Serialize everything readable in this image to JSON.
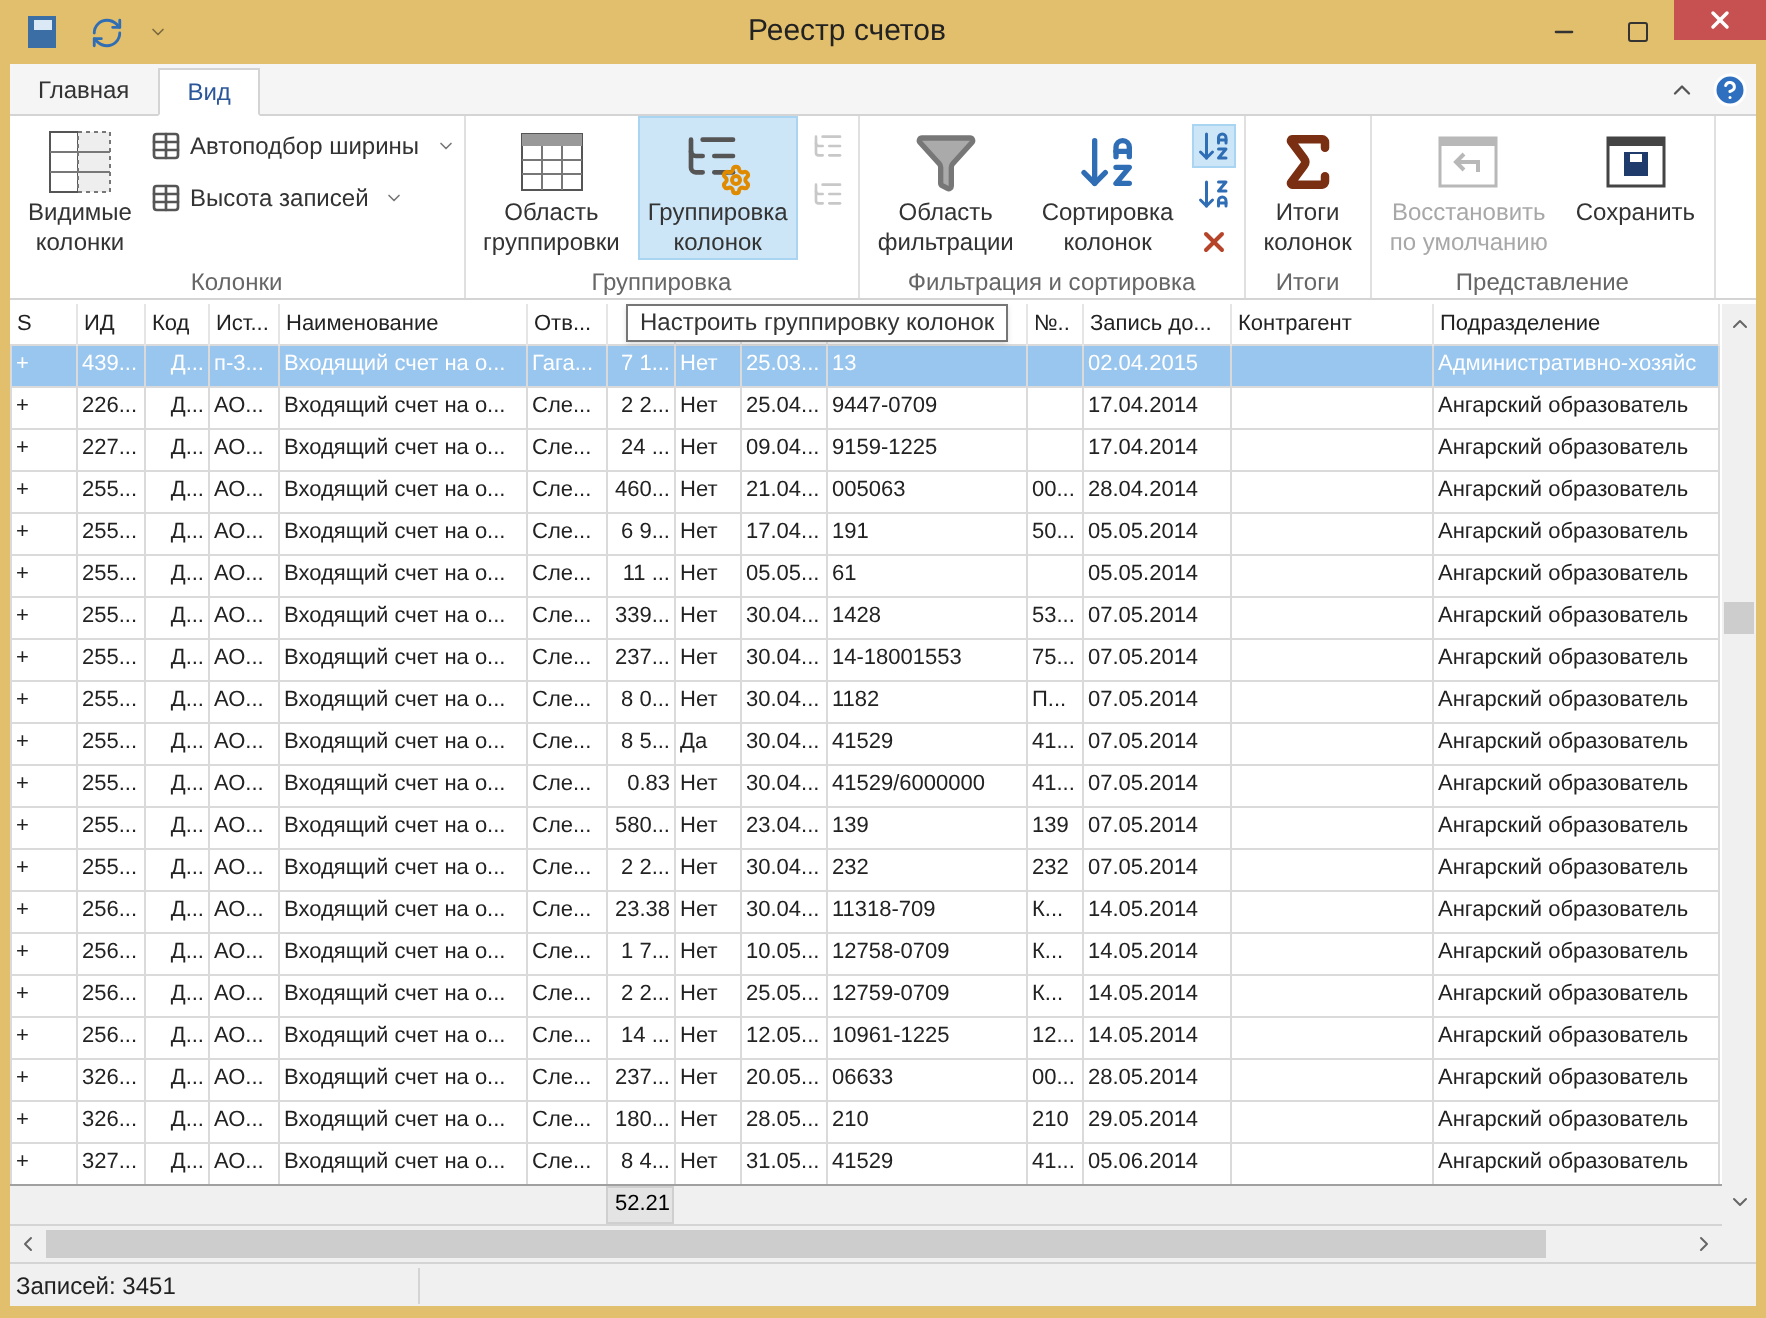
{
  "window": {
    "title": "Реестр счетов"
  },
  "tabs": [
    {
      "label": "Главная",
      "selected": false
    },
    {
      "label": "Вид",
      "selected": true
    }
  ],
  "ribbon": [
    {
      "label": "Колонки",
      "items": [
        {
          "kind": "large",
          "lines": [
            "Видимые",
            "колонки"
          ],
          "selected": false,
          "disabled": false
        },
        {
          "kind": "stack",
          "buttons": [
            {
              "label": "Автоподбор ширины"
            },
            {
              "label": "Высота записей"
            }
          ]
        }
      ]
    },
    {
      "label": "Группировка",
      "items": [
        {
          "kind": "large",
          "lines": [
            "Область",
            "группировки"
          ],
          "selected": false,
          "disabled": false
        },
        {
          "kind": "large",
          "lines": [
            "Группировка",
            "колонок"
          ],
          "selected": true,
          "disabled": false
        },
        {
          "kind": "mini",
          "icons": [
            {
              "selected": false,
              "disabled": true
            },
            {
              "selected": false,
              "disabled": true
            }
          ]
        }
      ]
    },
    {
      "label": "Фильтрация и сортировка",
      "items": [
        {
          "kind": "large",
          "lines": [
            "Область",
            "фильтрации"
          ],
          "selected": false,
          "disabled": false
        },
        {
          "kind": "large",
          "lines": [
            "Сортировка",
            "колонок"
          ],
          "selected": false,
          "disabled": false
        },
        {
          "kind": "mini",
          "icons": [
            {
              "selected": true,
              "disabled": false
            },
            {
              "selected": false,
              "disabled": false
            },
            {
              "selected": false,
              "disabled": false
            }
          ]
        }
      ]
    },
    {
      "label": "Итоги",
      "items": [
        {
          "kind": "large",
          "lines": [
            "Итоги",
            "колонок"
          ],
          "selected": false,
          "disabled": false
        }
      ]
    },
    {
      "label": "Представление",
      "items": [
        {
          "kind": "large",
          "lines": [
            "Восстановить",
            "по умолчанию"
          ],
          "selected": false,
          "disabled": true
        },
        {
          "kind": "large",
          "lines": [
            "Сохранить"
          ],
          "selected": false,
          "disabled": false
        }
      ]
    }
  ],
  "tooltip": "Настроить группировку колонок",
  "table": {
    "columns": [
      "S",
      "ИД",
      "Код",
      "Ист...",
      "Наименование",
      "Отв...",
      null,
      null,
      null,
      null,
      "№..",
      "Запись до...",
      "Контрагент",
      "Подразделение"
    ],
    "rows": [
      {
        "selected": true,
        "cells": [
          "+",
          "439...",
          "Д...",
          "п-3...",
          "Входящий счет на о...",
          "Гага...",
          "7 1...",
          "Нет",
          "25.03...",
          "13",
          null,
          "02.04.2015",
          null,
          "Административно-хозяйс"
        ]
      },
      {
        "selected": false,
        "cells": [
          "+",
          "226...",
          "Д...",
          "АО...",
          "Входящий счет на о...",
          "Сле...",
          "2 2...",
          "Нет",
          "25.04...",
          "9447-0709",
          null,
          "17.04.2014",
          null,
          "Ангарский образователь"
        ]
      },
      {
        "selected": false,
        "cells": [
          "+",
          "227...",
          "Д...",
          "АО...",
          "Входящий счет на о...",
          "Сле...",
          "24 ...",
          "Нет",
          "09.04...",
          "9159-1225",
          null,
          "17.04.2014",
          null,
          "Ангарский образователь"
        ]
      },
      {
        "selected": false,
        "cells": [
          "+",
          "255...",
          "Д...",
          "АО...",
          "Входящий счет на о...",
          "Сле...",
          "460...",
          "Нет",
          "21.04...",
          "005063",
          "00...",
          "28.04.2014",
          null,
          "Ангарский образователь"
        ]
      },
      {
        "selected": false,
        "cells": [
          "+",
          "255...",
          "Д...",
          "АО...",
          "Входящий счет на о...",
          "Сле...",
          "6 9...",
          "Нет",
          "17.04...",
          "191",
          "50...",
          "05.05.2014",
          null,
          "Ангарский образователь"
        ]
      },
      {
        "selected": false,
        "cells": [
          "+",
          "255...",
          "Д...",
          "АО...",
          "Входящий счет на о...",
          "Сле...",
          "11 ...",
          "Нет",
          "05.05...",
          "61",
          null,
          "05.05.2014",
          null,
          "Ангарский образователь"
        ]
      },
      {
        "selected": false,
        "cells": [
          "+",
          "255...",
          "Д...",
          "АО...",
          "Входящий счет на о...",
          "Сле...",
          "339...",
          "Нет",
          "30.04...",
          "1428",
          "53...",
          "07.05.2014",
          null,
          "Ангарский образователь"
        ]
      },
      {
        "selected": false,
        "cells": [
          "+",
          "255...",
          "Д...",
          "АО...",
          "Входящий счет на о...",
          "Сле...",
          "237...",
          "Нет",
          "30.04...",
          "14-18001553",
          "75...",
          "07.05.2014",
          null,
          "Ангарский образователь"
        ]
      },
      {
        "selected": false,
        "cells": [
          "+",
          "255...",
          "Д...",
          "АО...",
          "Входящий счет на о...",
          "Сле...",
          "8 0...",
          "Нет",
          "30.04...",
          "1182",
          "П...",
          "07.05.2014",
          null,
          "Ангарский образователь"
        ]
      },
      {
        "selected": false,
        "cells": [
          "+",
          "255...",
          "Д...",
          "АО...",
          "Входящий счет на о...",
          "Сле...",
          "8 5...",
          "Да",
          "30.04...",
          "41529",
          "41...",
          "07.05.2014",
          null,
          "Ангарский образователь"
        ]
      },
      {
        "selected": false,
        "cells": [
          "+",
          "255...",
          "Д...",
          "АО...",
          "Входящий счет на о...",
          "Сле...",
          "0.83",
          "Нет",
          "30.04...",
          "41529/6000000",
          "41...",
          "07.05.2014",
          null,
          "Ангарский образователь"
        ]
      },
      {
        "selected": false,
        "cells": [
          "+",
          "255...",
          "Д...",
          "АО...",
          "Входящий счет на о...",
          "Сле...",
          "580...",
          "Нет",
          "23.04...",
          "139",
          "139",
          "07.05.2014",
          null,
          "Ангарский образователь"
        ]
      },
      {
        "selected": false,
        "cells": [
          "+",
          "255...",
          "Д...",
          "АО...",
          "Входящий счет на о...",
          "Сле...",
          "2 2...",
          "Нет",
          "30.04...",
          "232",
          "232",
          "07.05.2014",
          null,
          "Ангарский образователь"
        ]
      },
      {
        "selected": false,
        "cells": [
          "+",
          "256...",
          "Д...",
          "АО...",
          "Входящий счет на о...",
          "Сле...",
          "23.38",
          "Нет",
          "30.04...",
          "11318-709",
          "К...",
          "14.05.2014",
          null,
          "Ангарский образователь"
        ]
      },
      {
        "selected": false,
        "cells": [
          "+",
          "256...",
          "Д...",
          "АО...",
          "Входящий счет на о...",
          "Сле...",
          "1 7...",
          "Нет",
          "10.05...",
          "12758-0709",
          "К...",
          "14.05.2014",
          null,
          "Ангарский образователь"
        ]
      },
      {
        "selected": false,
        "cells": [
          "+",
          "256...",
          "Д...",
          "АО...",
          "Входящий счет на о...",
          "Сле...",
          "2 2...",
          "Нет",
          "25.05...",
          "12759-0709",
          "К...",
          "14.05.2014",
          null,
          "Ангарский образователь"
        ]
      },
      {
        "selected": false,
        "cells": [
          "+",
          "256...",
          "Д...",
          "АО...",
          "Входящий счет на о...",
          "Сле...",
          "14 ...",
          "Нет",
          "12.05...",
          "10961-1225",
          "12...",
          "14.05.2014",
          null,
          "Ангарский образователь"
        ]
      },
      {
        "selected": false,
        "cells": [
          "+",
          "326...",
          "Д...",
          "АО...",
          "Входящий счет на о...",
          "Сле...",
          "237...",
          "Нет",
          "20.05...",
          "06633",
          "00...",
          "28.05.2014",
          null,
          "Ангарский образователь"
        ]
      },
      {
        "selected": false,
        "cells": [
          "+",
          "326...",
          "Д...",
          "АО...",
          "Входящий счет на о...",
          "Сле...",
          "180...",
          "Нет",
          "28.05...",
          "210",
          "210",
          "29.05.2014",
          null,
          "Ангарский образователь"
        ]
      },
      {
        "selected": false,
        "cells": [
          "+",
          "327...",
          "Д...",
          "АО...",
          "Входящий счет на о...",
          "Сле...",
          "8 4...",
          "Нет",
          "31.05...",
          "41529",
          "41...",
          "05.06.2014",
          null,
          "Ангарский образователь"
        ]
      }
    ],
    "totals": {
      "column_7": "52.21"
    }
  },
  "status_bar": "Записей: 3451"
}
